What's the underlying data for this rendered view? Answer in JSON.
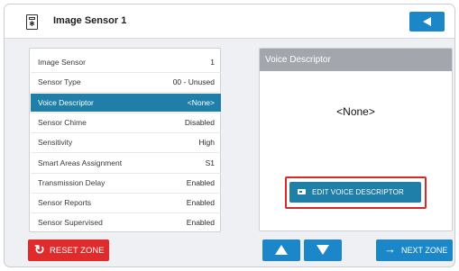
{
  "header": {
    "title": "Image Sensor 1",
    "device_icon": "image-sensor-icon",
    "back_icon": "back-arrow-icon"
  },
  "settings": [
    {
      "label": "Image Sensor",
      "value": "1"
    },
    {
      "label": "Sensor Type",
      "value": "00 - Unused"
    },
    {
      "label": "Voice Descriptor",
      "value": "<None>",
      "selected": true
    },
    {
      "label": "Sensor Chime",
      "value": "Disabled"
    },
    {
      "label": "Sensitivity",
      "value": "High"
    },
    {
      "label": "Smart Areas Assignment",
      "value": "S1"
    },
    {
      "label": "Transmission Delay",
      "value": "Enabled"
    },
    {
      "label": "Sensor Reports",
      "value": "Enabled"
    },
    {
      "label": "Sensor Supervised",
      "value": "Enabled"
    }
  ],
  "detail": {
    "heading": "Voice Descriptor",
    "value": "<None>",
    "edit_label": "EDIT VOICE DESCRIPTOR",
    "edit_icon": "keyboard-icon"
  },
  "footer": {
    "reset_label": "RESET ZONE",
    "reset_icon": "refresh-icon",
    "up_icon": "up-arrow-icon",
    "down_icon": "down-arrow-icon",
    "next_label": "NEXT ZONE",
    "next_icon": "right-arrow-icon"
  },
  "colors": {
    "primary": "#1b87c9",
    "selected_row": "#1f7fa8",
    "danger": "#df2b2b",
    "highlight_outline": "#d42a2a"
  }
}
